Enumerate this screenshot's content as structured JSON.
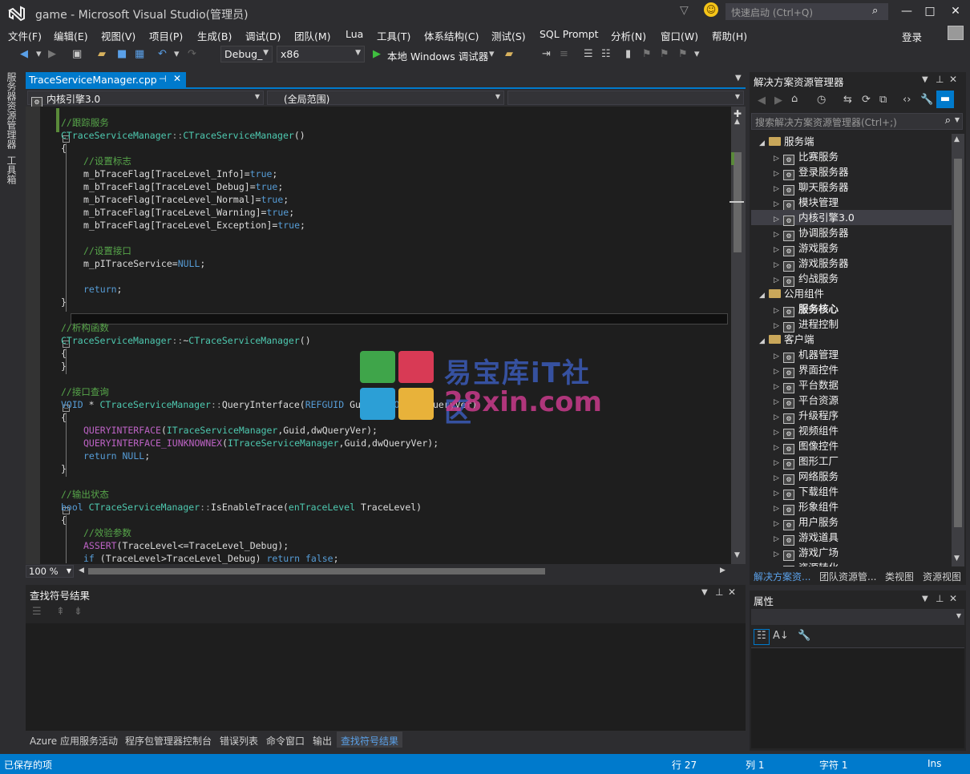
{
  "window": {
    "title": "game - Microsoft Visual Studio(管理员)",
    "quick_launch_placeholder": "快速启动 (Ctrl+Q)",
    "login": "登录"
  },
  "menu": [
    "文件(F)",
    "编辑(E)",
    "视图(V)",
    "项目(P)",
    "生成(B)",
    "调试(D)",
    "团队(M)",
    "Lua",
    "工具(T)",
    "体系结构(C)",
    "测试(S)",
    "SQL Prompt",
    "分析(N)",
    "窗口(W)",
    "帮助(H)"
  ],
  "toolbar": {
    "config": "Debug_",
    "platform": "x86",
    "run_label": "本地 Windows 调试器"
  },
  "left_tabs": [
    "服务器资源管理器",
    "工具箱"
  ],
  "editor": {
    "tab_label": "TraceServiceManager.cpp",
    "nav_project": "内核引擎3.0",
    "nav_scope": "(全局范围)",
    "zoom": "100 %",
    "lines": [
      {
        "t": "//跟踪服务",
        "c": "cm",
        "i": 0
      },
      {
        "t": "CTraceServiceManager::CTraceServiceManager()",
        "c": "fn",
        "i": 0
      },
      {
        "t": "{",
        "c": "nm",
        "i": 0
      },
      {
        "t": "//设置标志",
        "c": "cm",
        "i": 1
      },
      {
        "t": "m_bTraceFlag[TraceLevel_Info]=true;",
        "c": "as",
        "i": 1
      },
      {
        "t": "m_bTraceFlag[TraceLevel_Debug]=true;",
        "c": "as",
        "i": 1
      },
      {
        "t": "m_bTraceFlag[TraceLevel_Normal]=true;",
        "c": "as",
        "i": 1
      },
      {
        "t": "m_bTraceFlag[TraceLevel_Warning]=true;",
        "c": "as",
        "i": 1
      },
      {
        "t": "m_bTraceFlag[TraceLevel_Exception]=true;",
        "c": "as",
        "i": 1
      },
      {
        "t": "",
        "c": "nm",
        "i": 0
      },
      {
        "t": "//设置接口",
        "c": "cm",
        "i": 1
      },
      {
        "t": "m_pITraceService=NULL;",
        "c": "as",
        "i": 1
      },
      {
        "t": "",
        "c": "nm",
        "i": 0
      },
      {
        "t": "return;",
        "c": "kw",
        "i": 1
      },
      {
        "t": "}",
        "c": "nm",
        "i": 0
      },
      {
        "t": "",
        "c": "nm",
        "i": 0
      },
      {
        "t": "//析构函数",
        "c": "cm",
        "i": 0
      },
      {
        "t": "CTraceServiceManager::~CTraceServiceManager()",
        "c": "fn",
        "i": 0
      },
      {
        "t": "{",
        "c": "nm",
        "i": 0
      },
      {
        "t": "}",
        "c": "nm",
        "i": 0
      },
      {
        "t": "",
        "c": "nm",
        "i": 0
      },
      {
        "t": "//接口查询",
        "c": "cm",
        "i": 0
      },
      {
        "t": "VOID * CTraceServiceManager::QueryInterface(REFGUID Guid, DWORD dwQueryVer)",
        "c": "fn2",
        "i": 0
      },
      {
        "t": "{",
        "c": "nm",
        "i": 0
      },
      {
        "t": "QUERYINTERFACE(ITraceServiceManager,Guid,dwQueryVer);",
        "c": "mac",
        "i": 1
      },
      {
        "t": "QUERYINTERFACE_IUNKNOWNEX(ITraceServiceManager,Guid,dwQueryVer);",
        "c": "mac",
        "i": 1
      },
      {
        "t": "return NULL;",
        "c": "kw",
        "i": 1
      },
      {
        "t": "}",
        "c": "nm",
        "i": 0
      },
      {
        "t": "",
        "c": "nm",
        "i": 0
      },
      {
        "t": "//输出状态",
        "c": "cm",
        "i": 0
      },
      {
        "t": "bool CTraceServiceManager::IsEnableTrace(enTraceLevel TraceLevel)",
        "c": "fn3",
        "i": 0
      },
      {
        "t": "{",
        "c": "nm",
        "i": 0
      },
      {
        "t": "//效验参数",
        "c": "cm",
        "i": 1
      },
      {
        "t": "ASSERT(TraceLevel<=TraceLevel_Debug);",
        "c": "mac",
        "i": 1
      },
      {
        "t": "if (TraceLevel>TraceLevel_Debug) return false;",
        "c": "kw",
        "i": 1
      }
    ]
  },
  "find_panel": {
    "title": "查找符号结果"
  },
  "bottom_tabs": [
    "Azure 应用服务活动",
    "程序包管理器控制台",
    "错误列表",
    "命令窗口",
    "输出",
    "查找符号结果"
  ],
  "solution": {
    "title": "解决方案资源管理器",
    "search_placeholder": "搜索解决方案资源管理器(Ctrl+;)",
    "nodes": [
      {
        "label": "服务端",
        "level": 0,
        "folder": true,
        "open": true
      },
      {
        "label": "比赛服务",
        "level": 1
      },
      {
        "label": "登录服务器",
        "level": 1
      },
      {
        "label": "聊天服务器",
        "level": 1
      },
      {
        "label": "模块管理",
        "level": 1
      },
      {
        "label": "内核引擎3.0",
        "level": 1,
        "selected": true
      },
      {
        "label": "协调服务器",
        "level": 1
      },
      {
        "label": "游戏服务",
        "level": 1
      },
      {
        "label": "游戏服务器",
        "level": 1
      },
      {
        "label": "约战服务",
        "level": 1
      },
      {
        "label": "公用组件",
        "level": 0,
        "folder": true,
        "open": true
      },
      {
        "label": "服务核心",
        "level": 1,
        "bold": true
      },
      {
        "label": "进程控制",
        "level": 1
      },
      {
        "label": "客户端",
        "level": 0,
        "folder": true,
        "open": true
      },
      {
        "label": "机器管理",
        "level": 1
      },
      {
        "label": "界面控件",
        "level": 1
      },
      {
        "label": "平台数据",
        "level": 1
      },
      {
        "label": "平台资源",
        "level": 1
      },
      {
        "label": "升级程序",
        "level": 1
      },
      {
        "label": "视频组件",
        "level": 1
      },
      {
        "label": "图像控件",
        "level": 1
      },
      {
        "label": "图形工厂",
        "level": 1
      },
      {
        "label": "网络服务",
        "level": 1
      },
      {
        "label": "下载组件",
        "level": 1
      },
      {
        "label": "形象组件",
        "level": 1
      },
      {
        "label": "用户服务",
        "level": 1
      },
      {
        "label": "游戏道具",
        "level": 1
      },
      {
        "label": "游戏广场",
        "level": 1
      },
      {
        "label": "资源转化",
        "level": 1
      }
    ],
    "tabs": [
      "解决方案资...",
      "团队资源管...",
      "类视图",
      "资源视图"
    ]
  },
  "properties": {
    "title": "属性"
  },
  "status": {
    "message": "已保存的项",
    "line": "行 27",
    "col": "列 1",
    "char": "字符 1",
    "mode": "Ins"
  },
  "watermark": {
    "line1": "易宝库iT社区",
    "line2": "28xin.com"
  },
  "colors": {
    "accent": "#007acc",
    "editor_bg": "#1e1e1e",
    "comment": "#57a64a",
    "keyword": "#569cd6",
    "type": "#4ec9b0",
    "macro": "#bd63c5"
  }
}
